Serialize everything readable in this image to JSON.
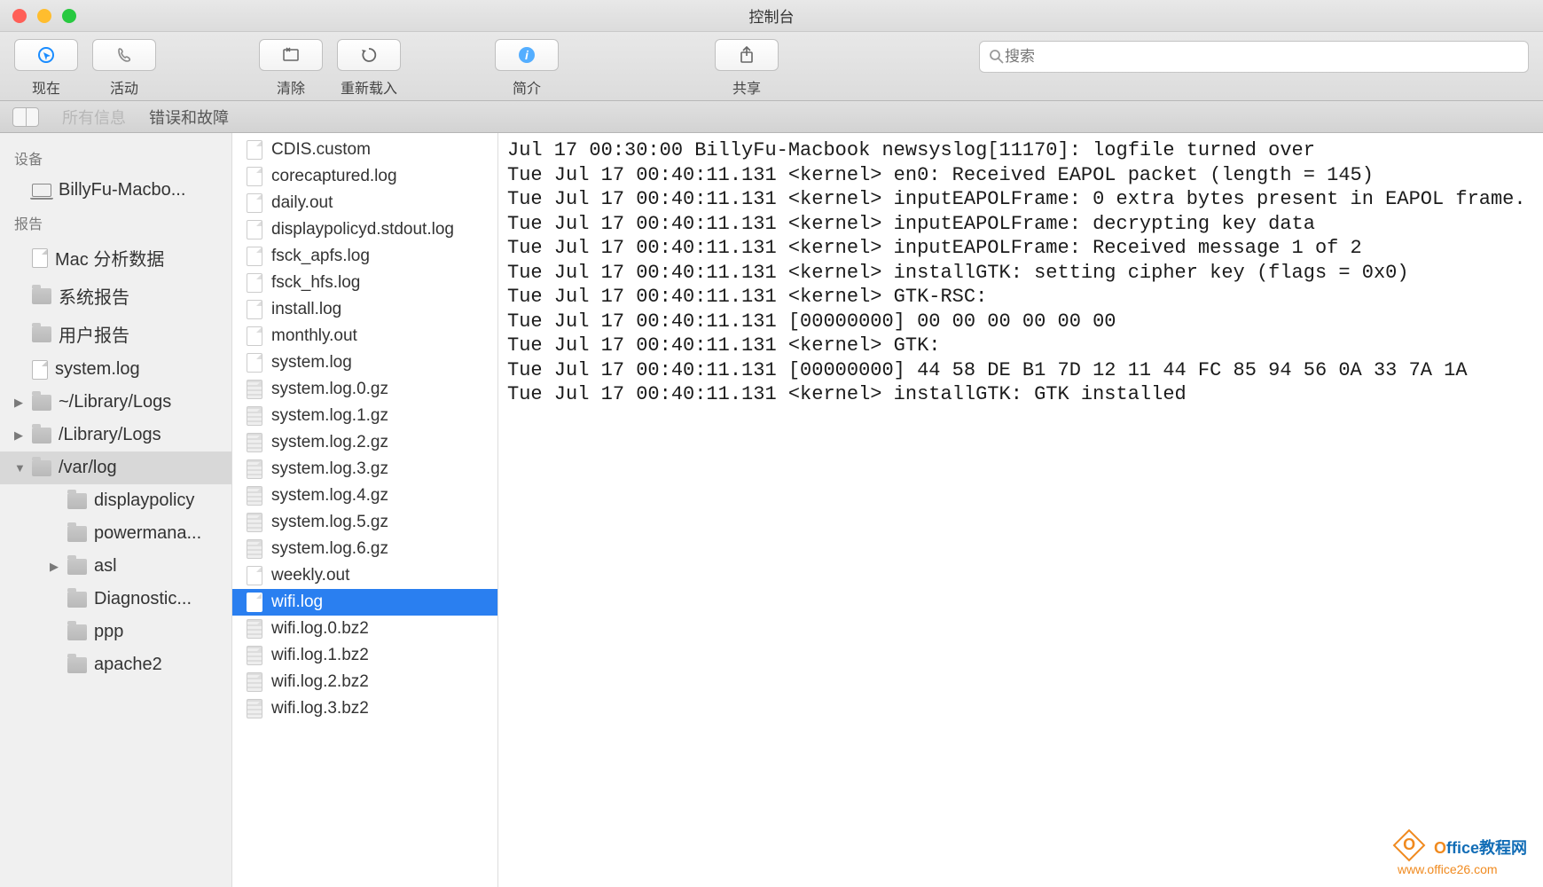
{
  "window": {
    "title": "控制台"
  },
  "toolbar": {
    "now": "现在",
    "activity": "活动",
    "clear": "清除",
    "reload": "重新载入",
    "info": "简介",
    "share": "共享",
    "search_placeholder": "搜索"
  },
  "filter": {
    "all": "所有信息",
    "errors": "错误和故障"
  },
  "sidebar": {
    "devices_header": "设备",
    "device": "BillyFu-Macbo...",
    "reports_header": "报告",
    "items": [
      {
        "label": "Mac 分析数据",
        "icon": "doc",
        "disclosure": ""
      },
      {
        "label": "系统报告",
        "icon": "folder",
        "disclosure": ""
      },
      {
        "label": "用户报告",
        "icon": "folder",
        "disclosure": ""
      },
      {
        "label": "system.log",
        "icon": "doc",
        "disclosure": ""
      },
      {
        "label": "~/Library/Logs",
        "icon": "folder",
        "disclosure": "▶"
      },
      {
        "label": "/Library/Logs",
        "icon": "folder",
        "disclosure": "▶"
      },
      {
        "label": "/var/log",
        "icon": "folder",
        "disclosure": "▼",
        "selected": true
      },
      {
        "label": "displaypolicy",
        "icon": "folder",
        "indent": true,
        "disclosure": ""
      },
      {
        "label": "powermana...",
        "icon": "folder",
        "indent": true,
        "disclosure": ""
      },
      {
        "label": "asl",
        "icon": "folder",
        "indent": true,
        "disclosure": "▶"
      },
      {
        "label": "Diagnostic...",
        "icon": "folder",
        "indent": true,
        "disclosure": ""
      },
      {
        "label": "ppp",
        "icon": "folder",
        "indent": true,
        "disclosure": ""
      },
      {
        "label": "apache2",
        "icon": "folder",
        "indent": true,
        "disclosure": ""
      }
    ]
  },
  "files": [
    {
      "name": "CDIS.custom",
      "type": "doc"
    },
    {
      "name": "corecaptured.log",
      "type": "doc"
    },
    {
      "name": "daily.out",
      "type": "doc"
    },
    {
      "name": "displaypolicyd.stdout.log",
      "type": "doc"
    },
    {
      "name": "fsck_apfs.log",
      "type": "doc"
    },
    {
      "name": "fsck_hfs.log",
      "type": "doc"
    },
    {
      "name": "install.log",
      "type": "doc"
    },
    {
      "name": "monthly.out",
      "type": "doc"
    },
    {
      "name": "system.log",
      "type": "doc"
    },
    {
      "name": "system.log.0.gz",
      "type": "gz"
    },
    {
      "name": "system.log.1.gz",
      "type": "gz"
    },
    {
      "name": "system.log.2.gz",
      "type": "gz"
    },
    {
      "name": "system.log.3.gz",
      "type": "gz"
    },
    {
      "name": "system.log.4.gz",
      "type": "gz"
    },
    {
      "name": "system.log.5.gz",
      "type": "gz"
    },
    {
      "name": "system.log.6.gz",
      "type": "gz"
    },
    {
      "name": "weekly.out",
      "type": "doc"
    },
    {
      "name": "wifi.log",
      "type": "doc",
      "selected": true
    },
    {
      "name": "wifi.log.0.bz2",
      "type": "gz"
    },
    {
      "name": "wifi.log.1.bz2",
      "type": "gz"
    },
    {
      "name": "wifi.log.2.bz2",
      "type": "gz"
    },
    {
      "name": "wifi.log.3.bz2",
      "type": "gz"
    }
  ],
  "log": "Jul 17 00:30:00 BillyFu-Macbook newsyslog[11170]: logfile turned over\nTue Jul 17 00:40:11.131 <kernel> en0: Received EAPOL packet (length = 145)\nTue Jul 17 00:40:11.131 <kernel> inputEAPOLFrame: 0 extra bytes present in EAPOL frame.\nTue Jul 17 00:40:11.131 <kernel> inputEAPOLFrame: decrypting key data\nTue Jul 17 00:40:11.131 <kernel> inputEAPOLFrame: Received message 1 of 2\nTue Jul 17 00:40:11.131 <kernel> installGTK: setting cipher key (flags = 0x0)\nTue Jul 17 00:40:11.131 <kernel> GTK-RSC:\nTue Jul 17 00:40:11.131 [00000000] 00 00 00 00 00 00\nTue Jul 17 00:40:11.131 <kernel> GTK:\nTue Jul 17 00:40:11.131 [00000000] 44 58 DE B1 7D 12 11 44 FC 85 94 56 0A 33 7A 1A\nTue Jul 17 00:40:11.131 <kernel> installGTK: GTK installed",
  "watermark": {
    "line1": "Office教程网",
    "line2": "www.office26.com"
  }
}
